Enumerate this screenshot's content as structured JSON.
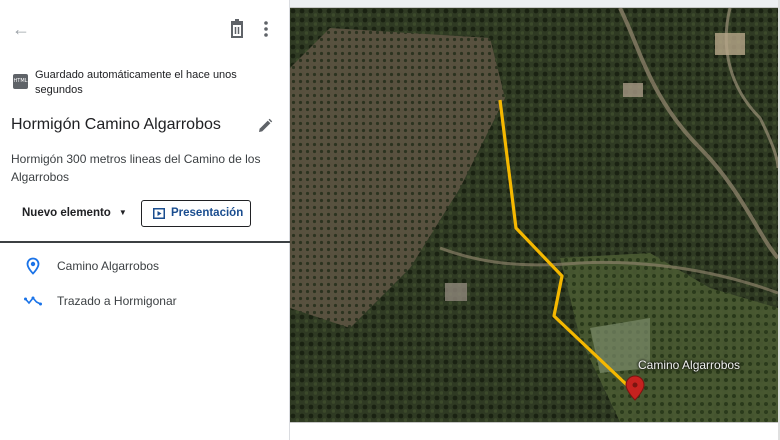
{
  "autosave": {
    "text": "Guardado automáticamente el hace unos segundos",
    "icon_text": "HTML"
  },
  "map": {
    "title": "Hormigón Camino Algarrobos",
    "description": "Hormigón 300 metros lineas del Camino de los Algarrobos"
  },
  "toolbar": {
    "new_item_label": "Nuevo elemento",
    "present_label": "Presentación"
  },
  "layers": [
    {
      "label": "Camino Algarrobos",
      "icon": "location-pin-icon"
    },
    {
      "label": "Trazado a Hormigonar",
      "icon": "polyline-icon"
    }
  ],
  "map_view": {
    "place_label": "Camino Algarrobos",
    "route_color": "#f5b800",
    "marker_color": "#c5221f"
  },
  "colors": {
    "accent": "#1a73e8",
    "present_text": "#1a4d8f"
  }
}
